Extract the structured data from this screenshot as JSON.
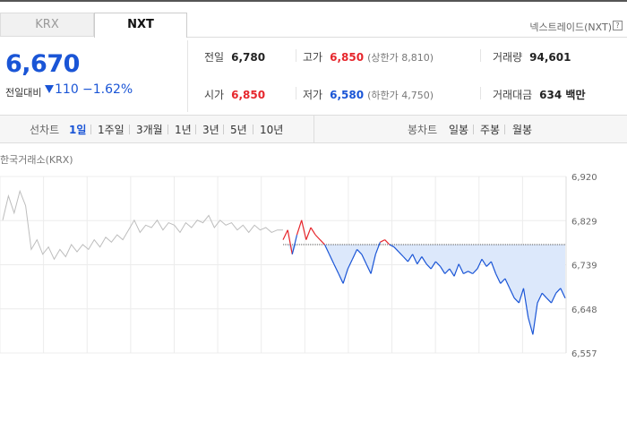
{
  "tabs": {
    "krx": "KRX",
    "nxt": "NXT"
  },
  "nxt_link": "넥스트레이드(NXT)",
  "help_icon_glyph": "?",
  "price": {
    "current": "6,670",
    "change_label": "전일대비",
    "change_value": "110",
    "change_pct": "−1.62%",
    "direction": "down"
  },
  "stats": {
    "prev_close": {
      "label": "전일",
      "value": "6,780"
    },
    "open": {
      "label": "시가",
      "value": "6,850"
    },
    "high": {
      "label": "고가",
      "value": "6,850",
      "limit": "(상한가 8,810)"
    },
    "low": {
      "label": "저가",
      "value": "6,580",
      "limit": "(하한가 4,750)"
    },
    "volume": {
      "label": "거래량",
      "value": "94,601"
    },
    "amount": {
      "label": "거래대금",
      "value": "634 백만"
    }
  },
  "period_bar": {
    "line_label": "선차트",
    "periods": [
      "1일",
      "1주일",
      "3개월",
      "1년",
      "3년",
      "5년",
      "10년"
    ],
    "active_period": "1일",
    "candle_label": "봉차트",
    "candle_periods": [
      "일봉",
      "주봉",
      "월봉"
    ]
  },
  "chart_title": "한국거래소(KRX)",
  "colors": {
    "up": "#e6262c",
    "down": "#1a55d6",
    "grey": "#bdbdbd",
    "fill": "#dce8fb"
  },
  "chart_data": {
    "type": "line",
    "title": "한국거래소(KRX)",
    "ylim": [
      6557,
      6920
    ],
    "y_ticks": [
      "6,920",
      "6,829",
      "6,739",
      "6,648",
      "6,557"
    ],
    "reference_price": 6780,
    "series": [
      {
        "values": [
          6830,
          6880,
          6845,
          6890,
          6860,
          6770,
          6790,
          6760,
          6775,
          6750,
          6770,
          6755,
          6780,
          6765,
          6780,
          6770,
          6790,
          6775,
          6795,
          6785,
          6800,
          6790,
          6810,
          6830,
          6805,
          6820,
          6815,
          6830,
          6810,
          6825,
          6820,
          6805,
          6825,
          6815,
          6830,
          6825,
          6840,
          6815,
          6830,
          6820,
          6825,
          6810,
          6820,
          6805,
          6820,
          6810,
          6815,
          6805,
          6810,
          6810
        ]
      },
      {
        "values": [
          6790,
          6810,
          6760,
          6800,
          6830,
          6790,
          6815,
          6800,
          6790,
          6780,
          6760,
          6740,
          6720,
          6700,
          6730,
          6750,
          6770,
          6760,
          6740,
          6720,
          6760,
          6785,
          6790,
          6780,
          6775,
          6765,
          6755,
          6745,
          6760,
          6740,
          6755,
          6740,
          6730,
          6745,
          6735,
          6720,
          6730,
          6715,
          6740,
          6720,
          6725,
          6720,
          6730,
          6750,
          6735,
          6745,
          6720,
          6700,
          6710,
          6690,
          6670,
          6660,
          6690,
          6630,
          6595,
          6660,
          6680,
          6670,
          6660,
          6680,
          6690,
          6670
        ]
      }
    ]
  }
}
